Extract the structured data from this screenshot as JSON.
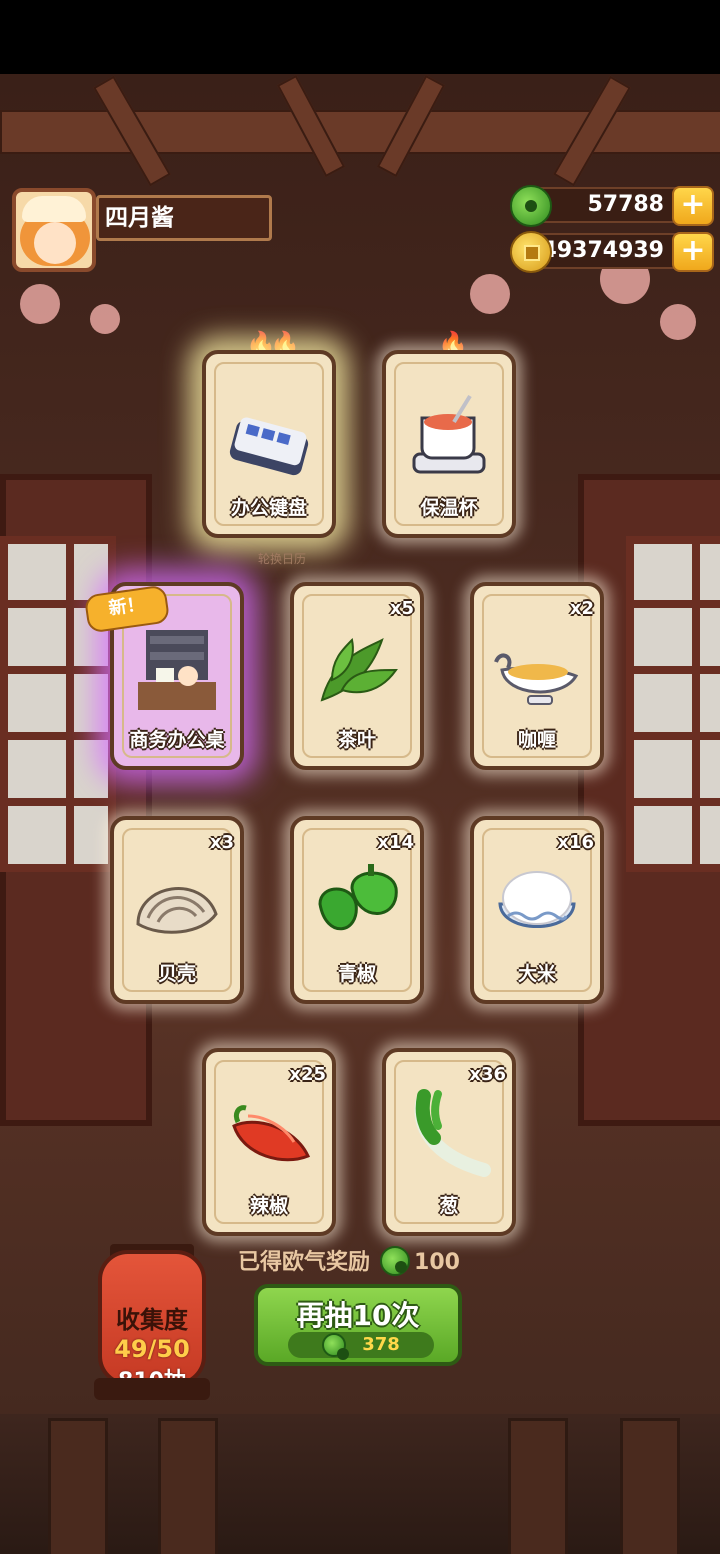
{
  "player": {
    "name": "四月酱"
  },
  "currencies": [
    {
      "id": "jade",
      "value": "57788",
      "icon": "jade-icon"
    },
    {
      "id": "coin",
      "value": "49374939",
      "icon": "coin-icon"
    }
  ],
  "caption": "轮换日历",
  "new_badge": "新！",
  "cards": [
    {
      "label": "办公键盘",
      "count": "",
      "icon": "keyboard-icon"
    },
    {
      "label": "保温杯",
      "count": "",
      "icon": "thermos-cup-icon"
    },
    {
      "label": "商务办公桌",
      "count": "",
      "icon": "office-desk-icon"
    },
    {
      "label": "茶叶",
      "count": "x5",
      "icon": "tea-leaf-icon"
    },
    {
      "label": "咖喱",
      "count": "x2",
      "icon": "curry-icon"
    },
    {
      "label": "贝壳",
      "count": "x3",
      "icon": "shell-icon"
    },
    {
      "label": "青椒",
      "count": "x14",
      "icon": "green-pepper-icon"
    },
    {
      "label": "大米",
      "count": "x16",
      "icon": "rice-icon"
    },
    {
      "label": "辣椒",
      "count": "x25",
      "icon": "chili-icon"
    },
    {
      "label": "葱",
      "count": "x36",
      "icon": "scallion-icon"
    }
  ],
  "collection": {
    "title": "收集度",
    "progress": "49/50",
    "draws": "810抽"
  },
  "reward": {
    "label": "已得欧气奖励",
    "value": "100"
  },
  "redraw": {
    "label": "再抽10次",
    "cost": "378"
  },
  "colors": {
    "accent_green": "#6bbf34",
    "gold": "#f0a81c",
    "card_bg": "#f3e3c2"
  }
}
